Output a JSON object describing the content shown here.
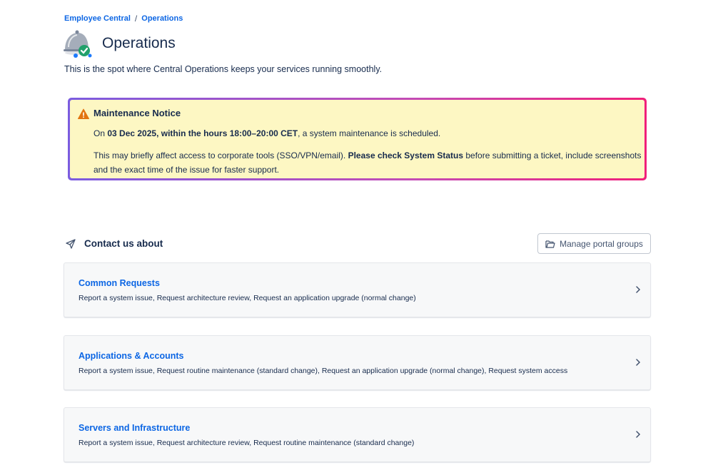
{
  "breadcrumb": {
    "root": "Employee Central",
    "separator": "/",
    "current": "Operations"
  },
  "header": {
    "title": "Operations",
    "description": "This is the spot where Central Operations keeps your services running smoothly.",
    "logo_icon": "dome-check-icon"
  },
  "notice": {
    "title": "Maintenance Notice",
    "line1_prefix": "On ",
    "line1_bold": "03 Dec 2025, within the hours 18:00–20:00 CET",
    "line1_suffix": ", a system maintenance is scheduled.",
    "line2_prefix": "This may briefly affect access to corporate tools (SSO/VPN/email). ",
    "line2_bold": "Please check System Status",
    "line2_suffix": " before submitting a ticket, include screenshots and the exact time of the issue for faster support.",
    "icon": "warning-icon",
    "background_color": "#fdf7c3",
    "border_gradient": [
      "#7b5ce0",
      "#f0207a"
    ]
  },
  "contact": {
    "title": "Contact us about",
    "icon": "send-icon"
  },
  "manage_button": {
    "label": "Manage portal groups",
    "icon": "folder-icon"
  },
  "groups": [
    {
      "title": "Common Requests",
      "description": "Report a system issue, Request architecture review, Request an application upgrade (normal change)"
    },
    {
      "title": "Applications & Accounts",
      "description": "Report a system issue, Request routine maintenance (standard change), Request an application upgrade (normal change), Request system access"
    },
    {
      "title": "Servers and Infrastructure",
      "description": "Report a system issue, Request architecture review, Request routine maintenance (standard change)"
    }
  ],
  "colors": {
    "link": "#0c66e4",
    "text": "#172b4d"
  }
}
